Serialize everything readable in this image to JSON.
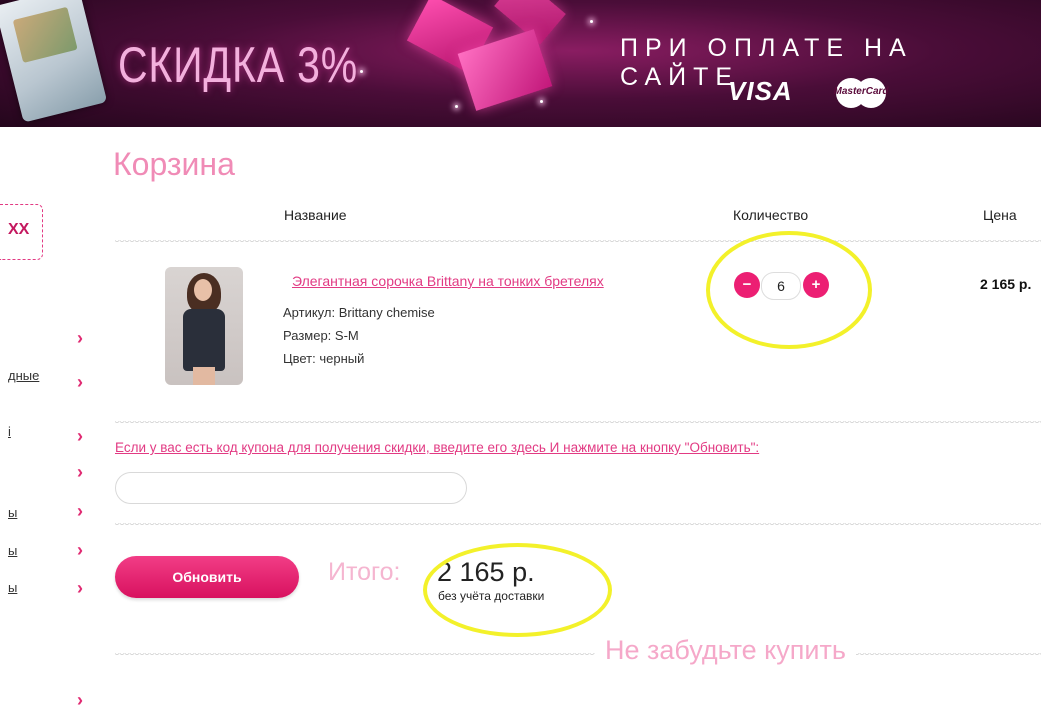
{
  "banner": {
    "promo": "СКИДКА 3%",
    "pay_text": "ПРИ ОПЛАТЕ НА САЙТЕ",
    "visa": "VISA",
    "mastercard": "MasterCard"
  },
  "sidebar": {
    "tag": "XX",
    "links": [
      "дные",
      "і",
      "ы",
      "ы",
      "ы"
    ]
  },
  "cart": {
    "title": "Корзина",
    "columns": {
      "name": "Название",
      "quantity": "Количество",
      "price": "Цена"
    },
    "item": {
      "name": "Элегантная сорочка Brittany на тонких бретелях",
      "article": "Артикул: Brittany chemise",
      "size": "Размер: S-M",
      "color": "Цвет: черный",
      "quantity": "6",
      "price": "2 165 р."
    },
    "qty_minus": "−",
    "qty_plus": "+",
    "coupon_text": "Если у вас есть код купона для получения скидки, введите его здесь И нажмите на кнопку \"Обновить\":",
    "coupon_value": "",
    "update_button": "Обновить",
    "total_label": "Итого:",
    "total_value": "2 165 р.",
    "total_note": "без учёта доставки",
    "dont_forget": "Не забудьте купить"
  },
  "colors": {
    "accent": "#ec1f73",
    "highlight": "#f3f12a",
    "banner_bg": "#4a0d38"
  }
}
